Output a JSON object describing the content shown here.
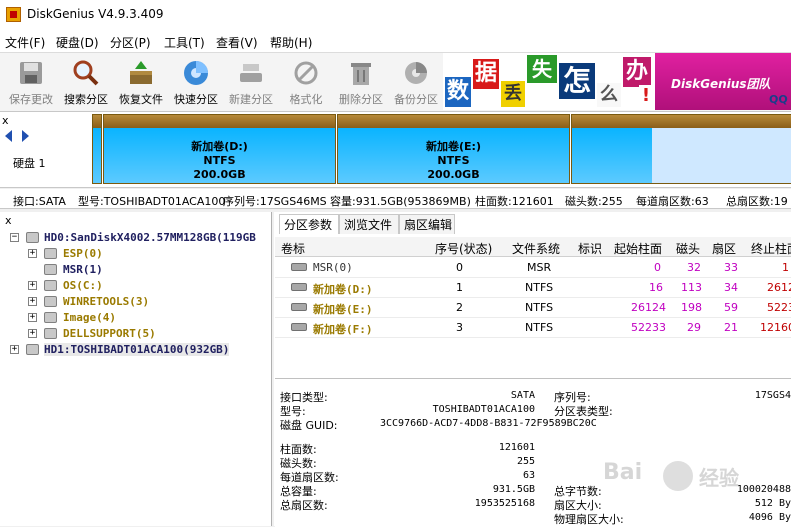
{
  "window": {
    "title": "DiskGenius V4.9.3.409"
  },
  "menu": [
    "文件(F)",
    "硬盘(D)",
    "分区(P)",
    "工具(T)",
    "查看(V)",
    "帮助(H)"
  ],
  "toolbar": [
    {
      "label": "保存更改",
      "icon": "save-disk-icon",
      "enabled": false
    },
    {
      "label": "搜索分区",
      "icon": "magnifier-icon",
      "enabled": true
    },
    {
      "label": "恢复文件",
      "icon": "recover-box-icon",
      "enabled": true
    },
    {
      "label": "快速分区",
      "icon": "quick-partition-icon",
      "enabled": true
    },
    {
      "label": "新建分区",
      "icon": "new-partition-icon",
      "enabled": false
    },
    {
      "label": "格式化",
      "icon": "format-icon",
      "enabled": false
    },
    {
      "label": "删除分区",
      "icon": "trash-icon",
      "enabled": false
    },
    {
      "label": "备份分区",
      "icon": "backup-icon",
      "enabled": false
    }
  ],
  "banner": {
    "chars": [
      "数",
      "据",
      "丢",
      "失",
      "怎",
      "么",
      "办",
      "!"
    ],
    "text": "DiskGenius团队",
    "qq": "QQ"
  },
  "diskbar": {
    "label": "硬盘 1",
    "close": "x",
    "partitions": [
      {
        "name": "新加卷(D:)",
        "fs": "NTFS",
        "size": "200.0GB"
      },
      {
        "name": "新加卷(E:)",
        "fs": "NTFS",
        "size": "200.0GB"
      }
    ]
  },
  "disk_info": {
    "interface": "接口:SATA",
    "model": "型号:TOSHIBADT01ACA100",
    "serial": "序列号:17SGS46MS",
    "capacity": "容量:931.5GB(953869MB)",
    "cylinders": "柱面数:121601",
    "heads": "磁头数:255",
    "sectors_per_track": "每道扇区数:63",
    "total_sectors": "总扇区数:19"
  },
  "tree": {
    "close": "x",
    "items": [
      {
        "text": "HD0:SanDiskX4002.57MM128GB(119GB",
        "level": 0,
        "expander": "−",
        "color": "navy"
      },
      {
        "text": "ESP(0)",
        "level": 1,
        "expander": "+",
        "color": "gold"
      },
      {
        "text": "MSR(1)",
        "level": 1,
        "expander": "",
        "color": "navy"
      },
      {
        "text": "OS(C:)",
        "level": 1,
        "expander": "+",
        "color": "gold"
      },
      {
        "text": "WINRETOOLS(3)",
        "level": 1,
        "expander": "+",
        "color": "gold"
      },
      {
        "text": "Image(4)",
        "level": 1,
        "expander": "+",
        "color": "gold"
      },
      {
        "text": "DELLSUPPORT(5)",
        "level": 1,
        "expander": "+",
        "color": "gold"
      },
      {
        "text": "HD1:TOSHIBADT01ACA100(932GB)",
        "level": 0,
        "expander": "+",
        "color": "navy",
        "selected": true
      }
    ]
  },
  "tabs": [
    "分区参数",
    "浏览文件",
    "扇区编辑"
  ],
  "table": {
    "headers": [
      "卷标",
      "序号(状态)",
      "文件系统",
      "标识",
      "起始柱面",
      "磁头",
      "扇区",
      "终止柱面"
    ],
    "rows": [
      {
        "label": "MSR(0)",
        "index": "0",
        "fs": "MSR",
        "id": "",
        "start_cyl": "0",
        "head": "32",
        "sector": "33",
        "end_cyl": "1"
      },
      {
        "label": "新加卷(D:)",
        "index": "1",
        "fs": "NTFS",
        "id": "",
        "start_cyl": "16",
        "head": "113",
        "sector": "34",
        "end_cyl": "2612"
      },
      {
        "label": "新加卷(E:)",
        "index": "2",
        "fs": "NTFS",
        "id": "",
        "start_cyl": "26124",
        "head": "198",
        "sector": "59",
        "end_cyl": "5223"
      },
      {
        "label": "新加卷(F:)",
        "index": "3",
        "fs": "NTFS",
        "id": "",
        "start_cyl": "52233",
        "head": "29",
        "sector": "21",
        "end_cyl": "12160"
      }
    ]
  },
  "details": {
    "interface_type": {
      "label": "接口类型:",
      "value": "SATA"
    },
    "model": {
      "label": "型号:",
      "value": "TOSHIBADT01ACA100"
    },
    "guid": {
      "label": "磁盘 GUID:",
      "value": "3CC9766D-ACD7-4DD8-B831-72F9589BC20C"
    },
    "serial": {
      "label": "序列号:",
      "value": "17SGS4"
    },
    "partition_table": {
      "label": "分区表类型:",
      "value": ""
    },
    "cylinders": {
      "label": "柱面数:",
      "value": "121601"
    },
    "heads": {
      "label": "磁头数:",
      "value": "255"
    },
    "sectors_per_track": {
      "label": "每道扇区数:",
      "value": "63"
    },
    "total_capacity": {
      "label": "总容量:",
      "value": "931.5GB"
    },
    "total_sectors": {
      "label": "总扇区数:",
      "value": "1953525168"
    },
    "total_bytes": {
      "label": "总字节数:",
      "value": "100020488"
    },
    "sector_size": {
      "label": "扇区大小:",
      "value": "512 By"
    },
    "physical_sector_size": {
      "label": "物理扇区大小:",
      "value": "4096 By"
    }
  },
  "watermark": {
    "left": "Bai",
    "right": "经验"
  }
}
